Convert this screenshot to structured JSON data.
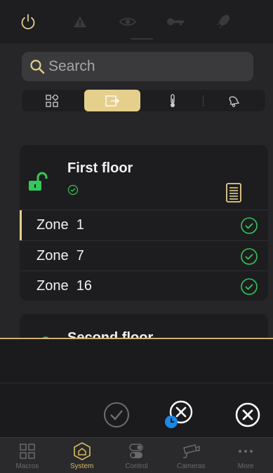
{
  "colors": {
    "accent": "#e5cf8c",
    "success": "#34c759",
    "danger": "#ffffff",
    "info": "#1e88e5"
  },
  "top_icons": [
    "power-icon",
    "warning-icon",
    "eye-icon",
    "key-icon",
    "rocket-icon"
  ],
  "search": {
    "placeholder": "Search"
  },
  "filters": [
    "grid-icon",
    "door-icon",
    "thermometer-icon",
    "bell-icon"
  ],
  "groups": [
    {
      "title": "First floor",
      "status": "unlocked",
      "zones": [
        {
          "label": "Zone  1"
        },
        {
          "label": "Zone  7"
        },
        {
          "label": "Zone  16"
        }
      ]
    },
    {
      "title": "Second floor"
    }
  ],
  "actions": [
    "check-icon",
    "clock-cancel-icon",
    "cancel-icon"
  ],
  "tabs": [
    {
      "label": "Macros",
      "icon": "grid-icon"
    },
    {
      "label": "System",
      "icon": "home-icon",
      "active": true
    },
    {
      "label": "Control",
      "icon": "toggle-icon"
    },
    {
      "label": "Cameras",
      "icon": "camera-icon"
    },
    {
      "label": "More",
      "icon": "more-icon"
    }
  ]
}
